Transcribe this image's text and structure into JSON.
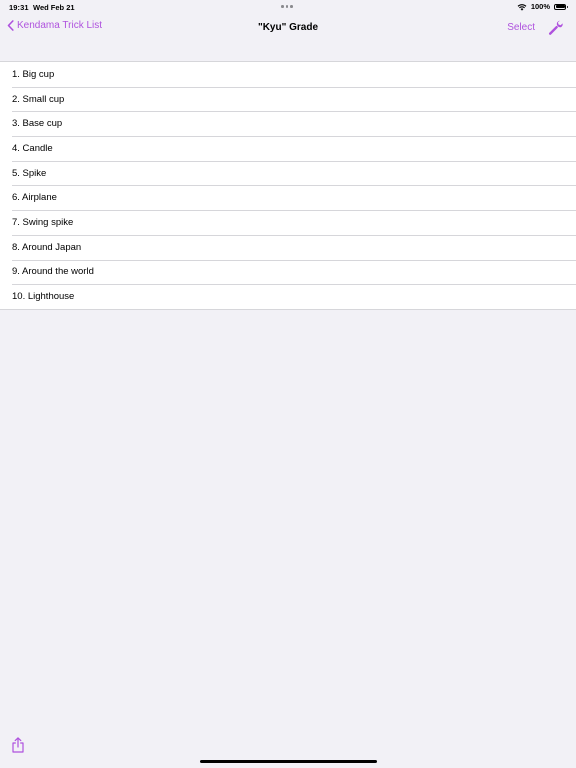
{
  "status_bar": {
    "time": "19:31",
    "date": "Wed Feb 21",
    "battery_percent": "100%",
    "wifi_icon": "wifi-icon",
    "battery_icon": "battery-icon",
    "multitasking_icon": "ellipsis-icon"
  },
  "nav": {
    "back_label": "Kendama Trick List",
    "back_icon": "chevron-left-icon",
    "title": "\"Kyu\" Grade",
    "select_label": "Select",
    "settings_icon": "wrench-icon"
  },
  "tricks": [
    "1. Big cup",
    "2. Small cup",
    "3. Base cup",
    "4. Candle",
    "5. Spike",
    "6. Airplane",
    "7. Swing spike",
    "8. Around Japan",
    "9. Around the world",
    "10. Lighthouse"
  ],
  "toolbar": {
    "share_icon": "share-icon"
  },
  "colors": {
    "accent": "#af52de",
    "background": "#f2f1f6",
    "list_background": "#ffffff",
    "separator": "#d6d6da"
  }
}
